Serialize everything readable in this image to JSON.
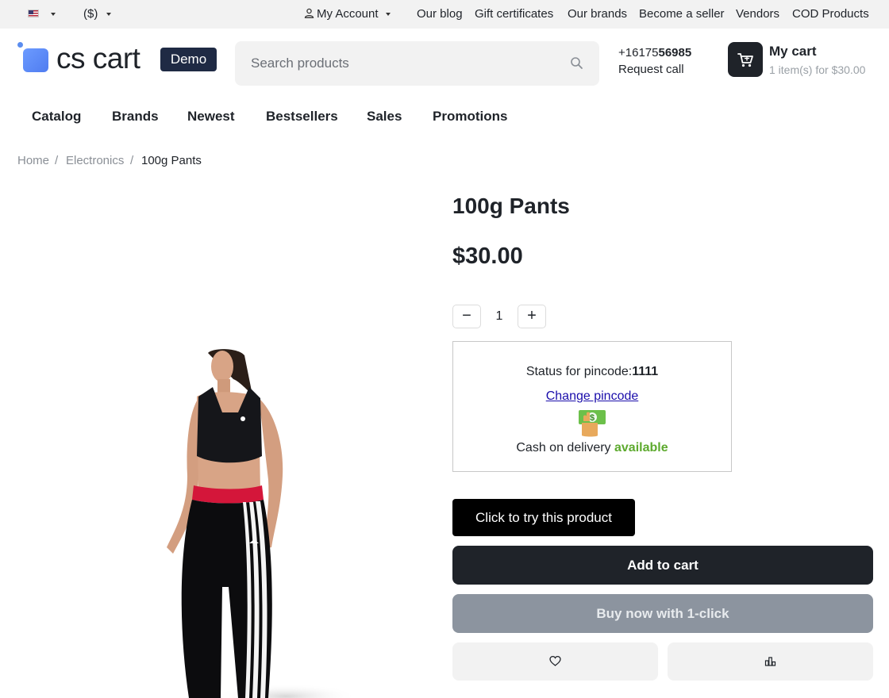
{
  "topbar": {
    "currency": "($)",
    "my_account": "My Account",
    "links": [
      "Our blog",
      "Gift certificates",
      "Our brands",
      "Become a seller",
      "Vendors",
      "COD Products"
    ]
  },
  "header": {
    "logo_text": "cs cart",
    "demo_badge": "Demo",
    "search_placeholder": "Search products",
    "phone_prefix": "+16175",
    "phone_bold": "56985",
    "request_call": "Request call",
    "cart_title": "My cart",
    "cart_summary": "1 item(s) for $30.00"
  },
  "nav": [
    "Catalog",
    "Brands",
    "Newest",
    "Bestsellers",
    "Sales",
    "Promotions"
  ],
  "breadcrumb": {
    "home": "Home",
    "category": "Electronics",
    "current": "100g Pants",
    "separator": "/"
  },
  "product": {
    "title": "100g Pants",
    "price": "$30.00",
    "quantity": "1",
    "qty_minus": "−",
    "qty_plus": "+",
    "pincode_label": "Status for pincode:",
    "pincode_value": "1111",
    "change_pincode": "Change pincode",
    "cod_text": "Cash on delivery",
    "cod_status": "available",
    "try_label": "Click to try this product",
    "add_to_cart": "Add to cart",
    "buy_now": "Buy now with 1-click"
  },
  "icons": {
    "account": "user-icon",
    "search": "search-icon",
    "cart": "cart-icon",
    "wishlist": "heart-icon",
    "compare": "compare-bars-icon",
    "cod": "cash-hand-icon",
    "flag": "us-flag-icon"
  },
  "colors": {
    "primary_dark": "#1f2329",
    "available_green": "#5daa2e",
    "buy_now_gray": "#8c949f",
    "link_blue": "#1a0dab",
    "logo_blue": "#5b8def"
  }
}
